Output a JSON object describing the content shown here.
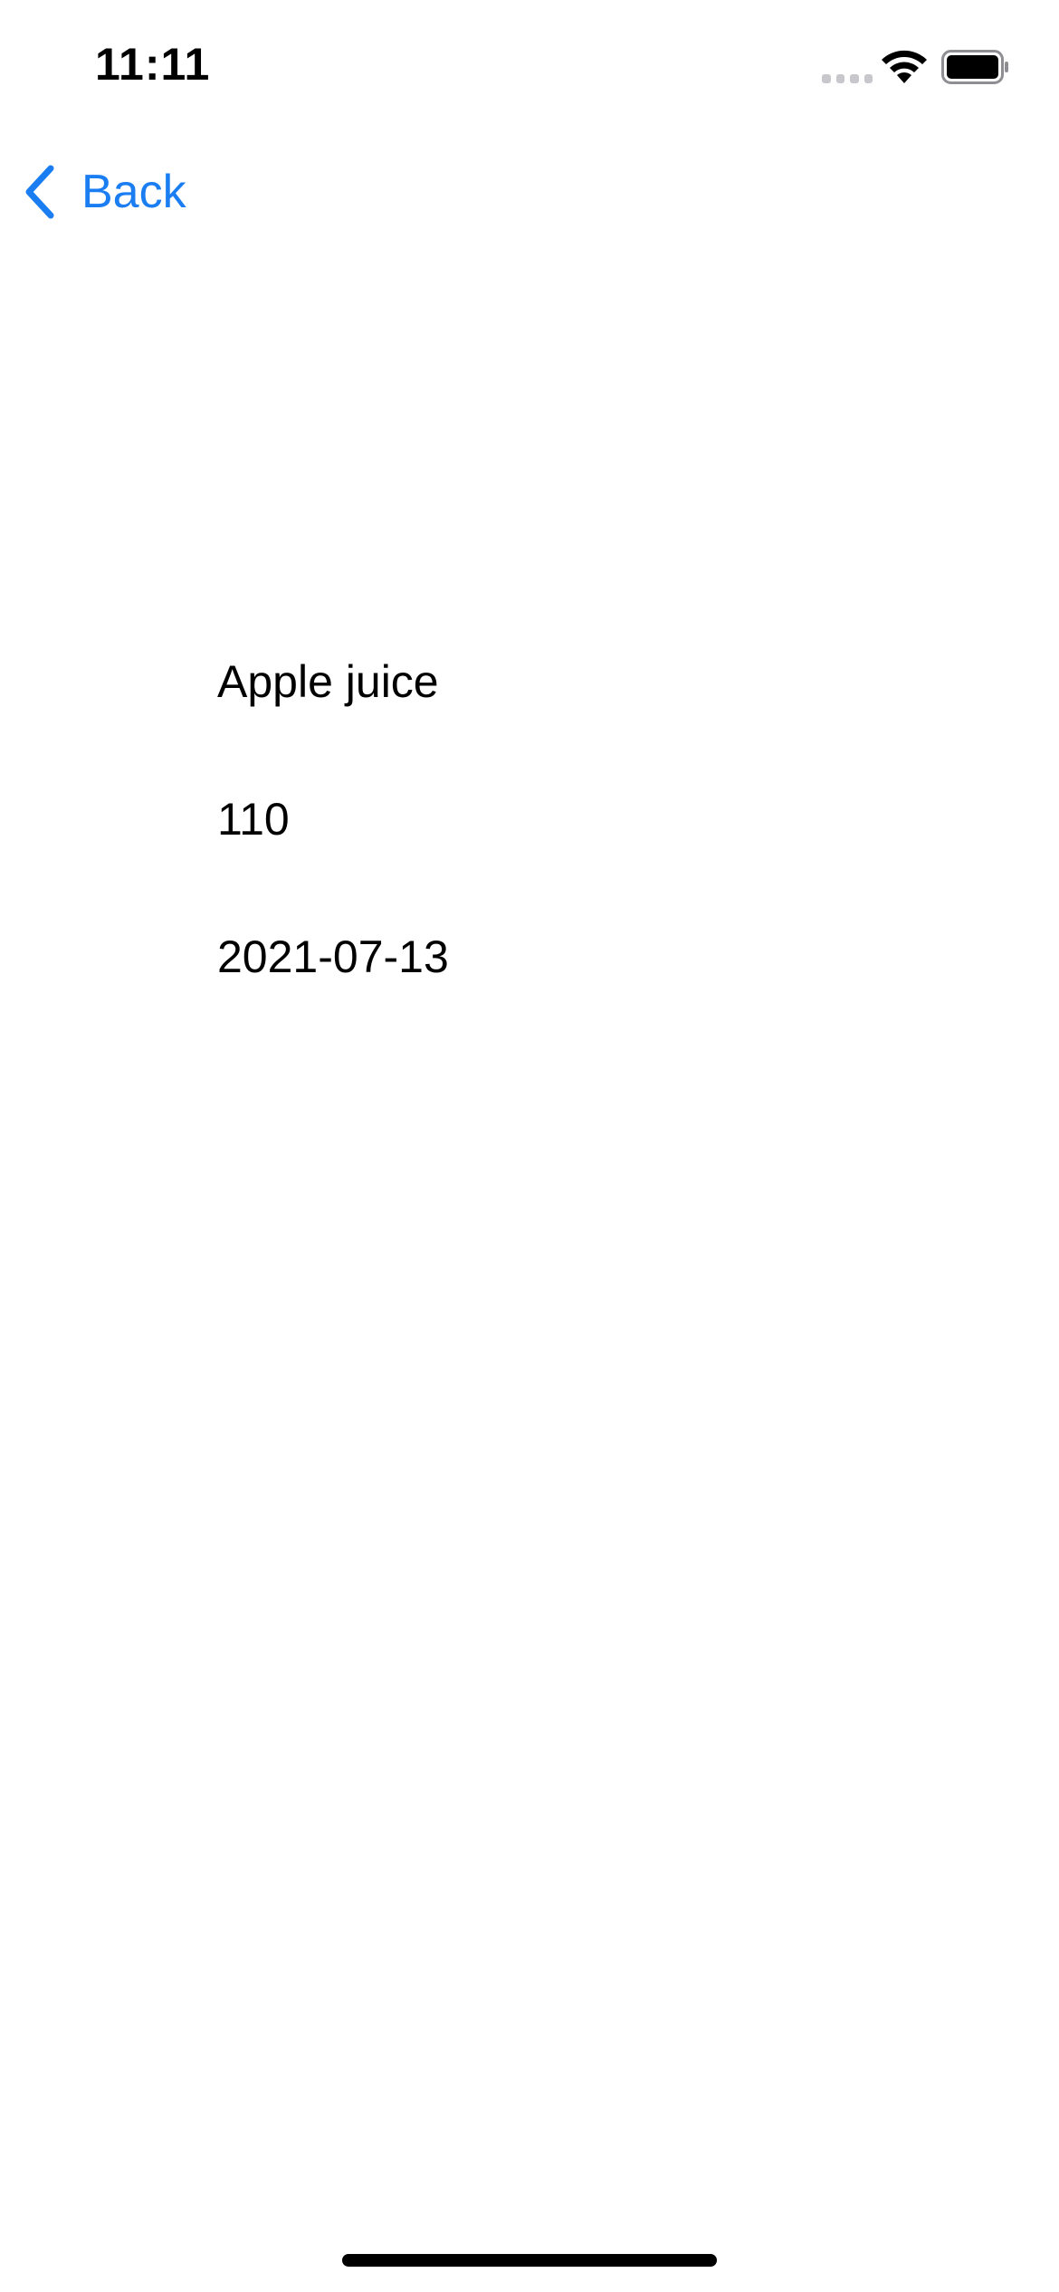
{
  "status_bar": {
    "time": "11:11",
    "icons": [
      "cellular-signal-icon",
      "wifi-icon",
      "battery-icon"
    ]
  },
  "nav": {
    "back_label": "Back",
    "back_icon": "chevron-left-icon",
    "accent_color": "#1a7ef2"
  },
  "detail": {
    "name": "Apple juice",
    "value": "110",
    "date": "2021-07-13"
  }
}
